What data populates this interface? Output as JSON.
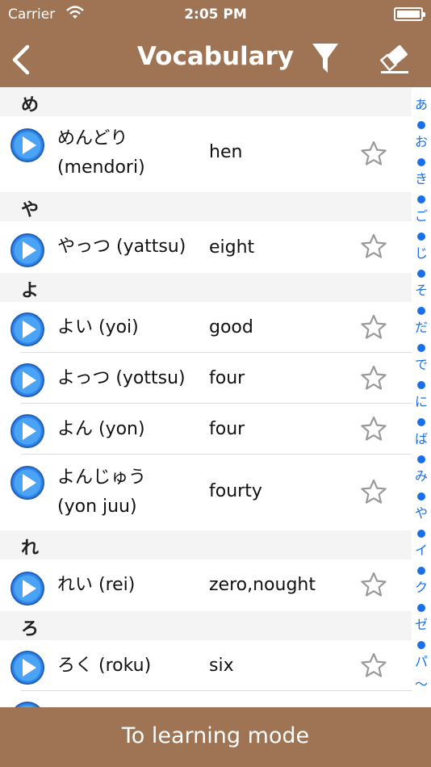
{
  "status": {
    "carrier": "Carrier",
    "time": "2:05 PM"
  },
  "nav": {
    "title": "Vocabulary"
  },
  "bottom": {
    "button_label": "To learning mode"
  },
  "colors": {
    "bar_brown": "#9e7455",
    "index_blue": "#1a6fe8"
  },
  "list": {
    "sec_me": {
      "header": "め",
      "rows": [
        {
          "word": "めんどり",
          "reading": "(mendori)",
          "meaning": "hen"
        }
      ]
    },
    "sec_ya": {
      "header": "や",
      "rows": [
        {
          "word": "やっつ (yattsu)",
          "meaning": "eight"
        }
      ]
    },
    "sec_yo": {
      "header": "よ",
      "rows": [
        {
          "word": "よい (yoi)",
          "meaning": "good"
        },
        {
          "word": "よっつ (yottsu)",
          "meaning": "four"
        },
        {
          "word": "よん (yon)",
          "meaning": "four"
        },
        {
          "word": "よんじゅう",
          "reading": "(yon juu)",
          "meaning": "fourty"
        }
      ]
    },
    "sec_re": {
      "header": "れ",
      "rows": [
        {
          "word": "れい (rei)",
          "meaning": "zero,nought"
        }
      ]
    },
    "sec_ro": {
      "header": "ろ",
      "rows": [
        {
          "word": "ろく (roku)",
          "meaning": "six"
        }
      ]
    }
  },
  "index": [
    "あ",
    "お",
    "き",
    "ご",
    "じ",
    "そ",
    "だ",
    "で",
    "に",
    "ば",
    "み",
    "や",
    "イ",
    "ク",
    "ゼ",
    "パ",
    "〜"
  ]
}
